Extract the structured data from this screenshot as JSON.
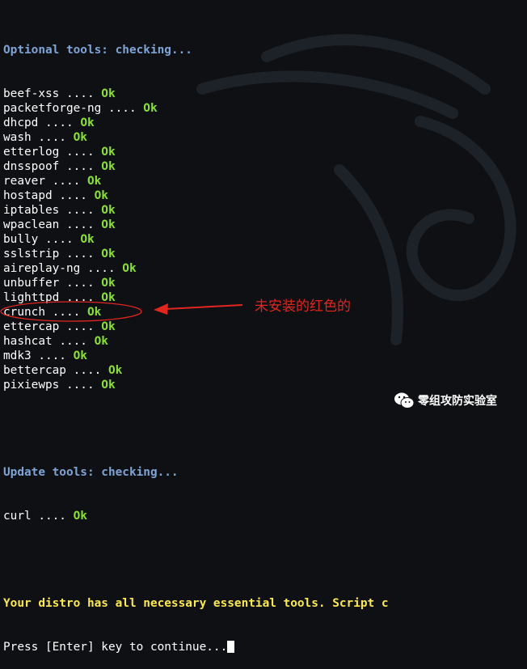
{
  "terminal": {
    "optional_header": "Optional tools: checking...",
    "tools": [
      {
        "name": "beef-xss",
        "status": "Ok"
      },
      {
        "name": "packetforge-ng",
        "status": "Ok"
      },
      {
        "name": "dhcpd",
        "status": "Ok"
      },
      {
        "name": "wash",
        "status": "Ok"
      },
      {
        "name": "etterlog",
        "status": "Ok"
      },
      {
        "name": "dnsspoof",
        "status": "Ok"
      },
      {
        "name": "reaver",
        "status": "Ok"
      },
      {
        "name": "hostapd",
        "status": "Ok"
      },
      {
        "name": "iptables",
        "status": "Ok"
      },
      {
        "name": "wpaclean",
        "status": "Ok"
      },
      {
        "name": "bully",
        "status": "Ok"
      },
      {
        "name": "sslstrip",
        "status": "Ok"
      },
      {
        "name": "aireplay-ng",
        "status": "Ok"
      },
      {
        "name": "unbuffer",
        "status": "Ok"
      },
      {
        "name": "lighttpd",
        "status": "Ok"
      },
      {
        "name": "crunch",
        "status": "Ok"
      },
      {
        "name": "ettercap",
        "status": "Ok"
      },
      {
        "name": "hashcat",
        "status": "Ok"
      },
      {
        "name": "mdk3",
        "status": "Ok"
      },
      {
        "name": "bettercap",
        "status": "Ok"
      },
      {
        "name": "pixiewps",
        "status": "Ok"
      }
    ],
    "dots": " .... ",
    "update_header": "Update tools: checking...",
    "update_tools": [
      {
        "name": "curl",
        "status": "Ok"
      }
    ],
    "summary": "Your distro has all necessary essential tools. Script c",
    "prompt": "Press [Enter] key to continue..."
  },
  "annotation": {
    "text": "未安装的红色的",
    "color": "#e0261f"
  },
  "watermark": {
    "text": "零组攻防实验室",
    "icon": "wechat-icon"
  },
  "colors": {
    "background": "#0e1014",
    "header_blue": "#7fa4d6",
    "ok_green": "#8ae234",
    "summary_yellow": "#fce94f"
  }
}
